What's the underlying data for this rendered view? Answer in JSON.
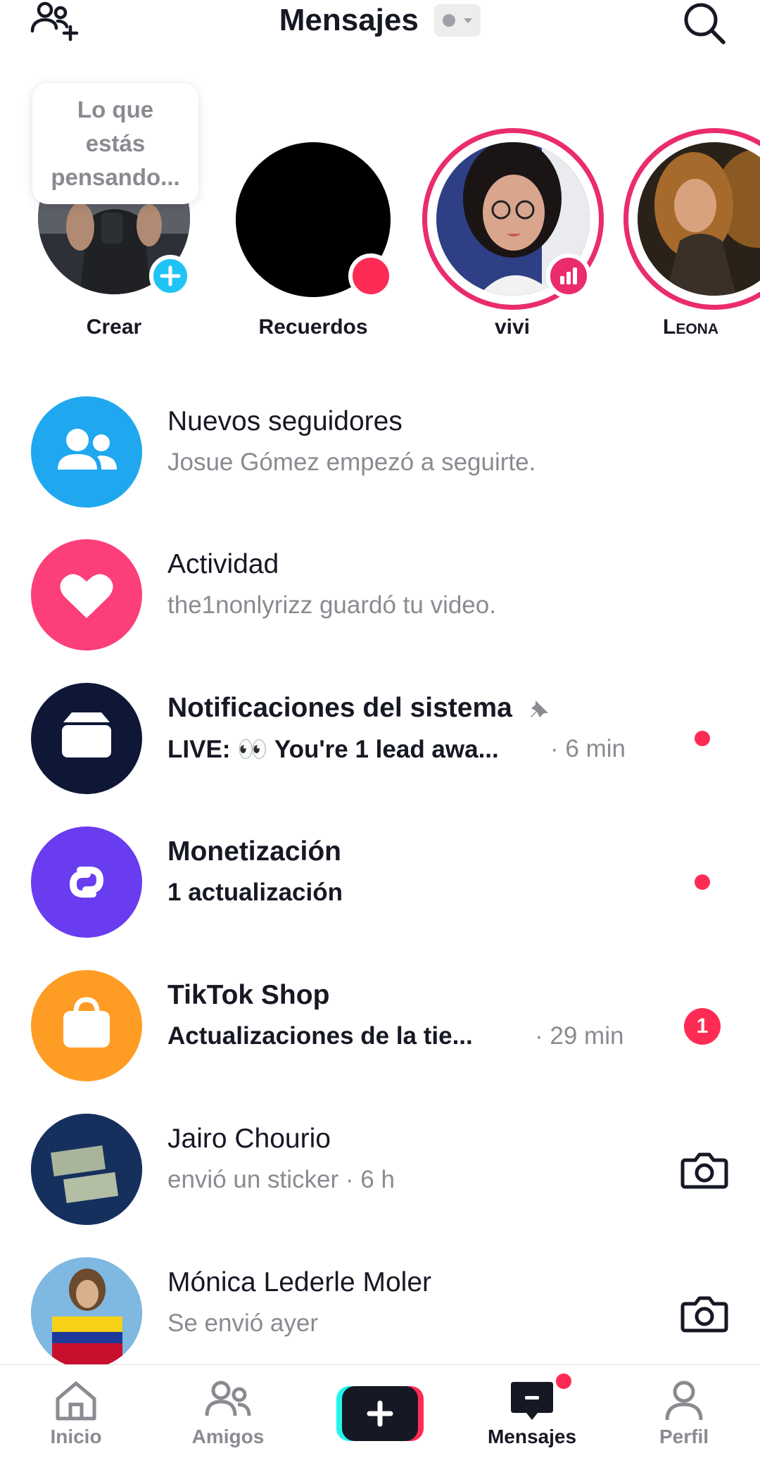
{
  "header": {
    "title": "Mensajes",
    "add_friend_icon": "add-friend-icon",
    "search_icon": "search-icon",
    "status_icon": "status-dot-dropdown"
  },
  "stories": {
    "thought_bubble": [
      "Lo que",
      "estás",
      "pensando..."
    ],
    "items": [
      {
        "label": "Crear"
      },
      {
        "label": "Recuerdos"
      },
      {
        "label": "vivi"
      },
      {
        "label": "Leona"
      }
    ]
  },
  "inbox": [
    {
      "title": "Nuevos seguidores",
      "subtitle": "Josue Gómez empezó a seguirte.",
      "icon": "followers-icon"
    },
    {
      "title": "Actividad",
      "subtitle": "the1nonlyrizz guardó tu video.",
      "icon": "heart-icon"
    },
    {
      "title": "Notificaciones del sistema",
      "subtitle": "LIVE: 👀 You're 1 lead awa...",
      "time": "· 6 min",
      "icon": "inbox-tray-icon",
      "pinned": true,
      "unread": true
    },
    {
      "title": "Monetización",
      "subtitle": "1 actualización",
      "icon": "link-icon",
      "unread": true
    },
    {
      "title": "TikTok Shop",
      "subtitle": "Actualizaciones de la tie...",
      "time": "· 29 min",
      "icon": "shopping-bag-icon",
      "badge": "1"
    },
    {
      "title": "Jairo Chourio",
      "subtitle": "envió un sticker · 6 h",
      "icon": "camera-icon"
    },
    {
      "title": "Mónica Lederle Moler",
      "subtitle": "Se envió ayer",
      "icon": "camera-icon"
    }
  ],
  "nav": {
    "items": [
      {
        "label": "Inicio",
        "icon": "home-icon"
      },
      {
        "label": "Amigos",
        "icon": "friends-icon"
      },
      {
        "label": "",
        "icon": "create-plus-icon"
      },
      {
        "label": "Mensajes",
        "icon": "messages-icon"
      },
      {
        "label": "Perfil",
        "icon": "profile-icon"
      }
    ]
  },
  "colors": {
    "accent_red": "#fe2c55",
    "followers_blue": "#1fa8f0",
    "activity_pink": "#fc3f79",
    "system_navy": "#0f1736",
    "monetization_purple": "#6a3cf0",
    "shop_orange": "#ff9c23",
    "story_ring": "#ea2c6c"
  }
}
